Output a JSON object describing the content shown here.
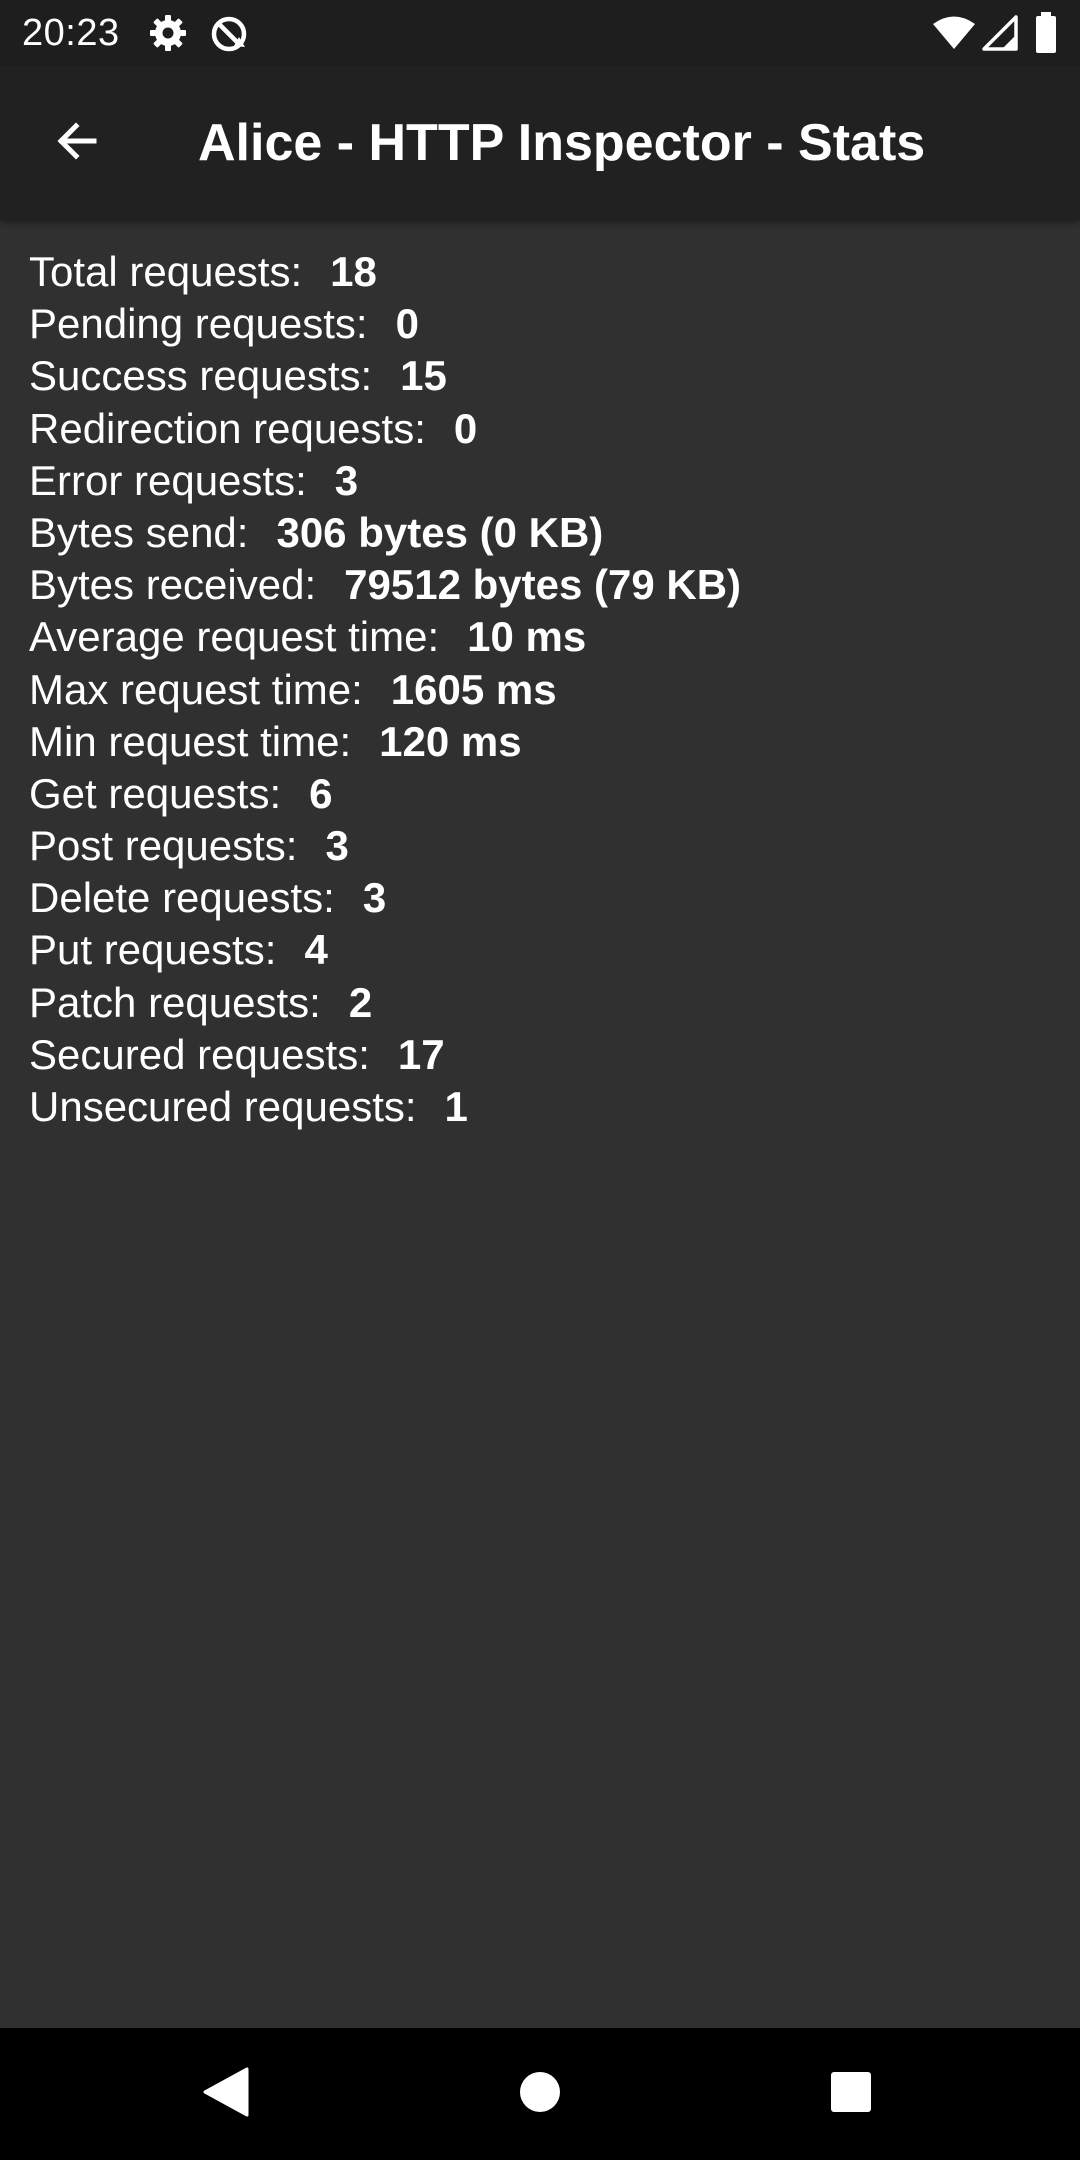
{
  "status_bar": {
    "time": "20:23",
    "icons": [
      "gear-icon",
      "sync-blocked-icon",
      "wifi-icon",
      "signal-icon",
      "battery-icon"
    ]
  },
  "app_bar": {
    "title": "Alice - HTTP Inspector - Stats",
    "back_icon": "arrow-back-icon"
  },
  "stats": [
    {
      "label": "Total requests:",
      "value": "18"
    },
    {
      "label": "Pending requests:",
      "value": "0"
    },
    {
      "label": "Success requests:",
      "value": "15"
    },
    {
      "label": "Redirection requests:",
      "value": "0"
    },
    {
      "label": "Error requests:",
      "value": "3"
    },
    {
      "label": "Bytes send:",
      "value": "306 bytes (0 KB)"
    },
    {
      "label": "Bytes received:",
      "value": "79512 bytes (79 KB)"
    },
    {
      "label": "Average request time:",
      "value": "10 ms"
    },
    {
      "label": "Max request time:",
      "value": "1605 ms"
    },
    {
      "label": "Min request time:",
      "value": "120 ms"
    },
    {
      "label": "Get requests:",
      "value": "6"
    },
    {
      "label": "Post requests:",
      "value": "3"
    },
    {
      "label": "Delete requests:",
      "value": "3"
    },
    {
      "label": "Put requests:",
      "value": "4"
    },
    {
      "label": "Patch requests:",
      "value": "2"
    },
    {
      "label": "Secured requests:",
      "value": "17"
    },
    {
      "label": "Unsecured requests:",
      "value": "1"
    }
  ],
  "nav_bar": {
    "icons": [
      "back-triangle-icon",
      "home-circle-icon",
      "recents-square-icon"
    ]
  },
  "colors": {
    "background": "#303030",
    "app_bar": "#212121",
    "status_bar": "#1e1e1e",
    "nav_bar": "#000000",
    "text": "#ffffff"
  }
}
